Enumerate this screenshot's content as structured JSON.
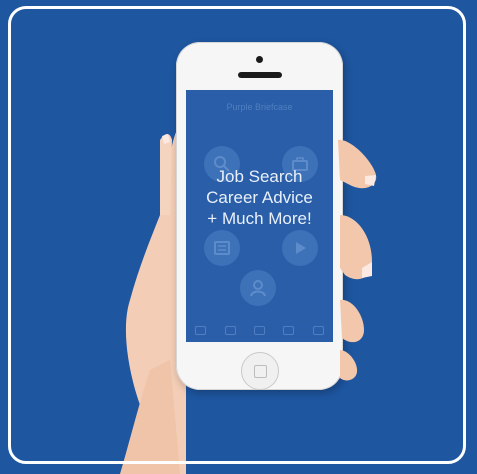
{
  "app": {
    "title": "Purple Briefcase"
  },
  "screen": {
    "line1": "Job Search",
    "line2": "Career Advice",
    "line3": "+ Much More!"
  },
  "icons": [
    "search-icon",
    "briefcase-icon",
    "document-icon",
    "play-icon",
    "profile-icon"
  ],
  "colors": {
    "background": "#1e56a0",
    "screen": "#2a5ea8",
    "phone": "#f6f6f6"
  }
}
